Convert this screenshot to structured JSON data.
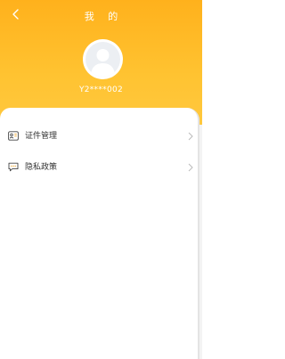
{
  "header": {
    "back_icon": "chevron-left-icon",
    "title": "我 的",
    "user_id": "Y2****002",
    "gradient_top": "#ffb11c",
    "gradient_bottom": "#ffc83e"
  },
  "menu": [
    {
      "label": "证件管理",
      "icon": "id-card-icon"
    },
    {
      "label": "隐私政策",
      "icon": "message-icon"
    }
  ]
}
